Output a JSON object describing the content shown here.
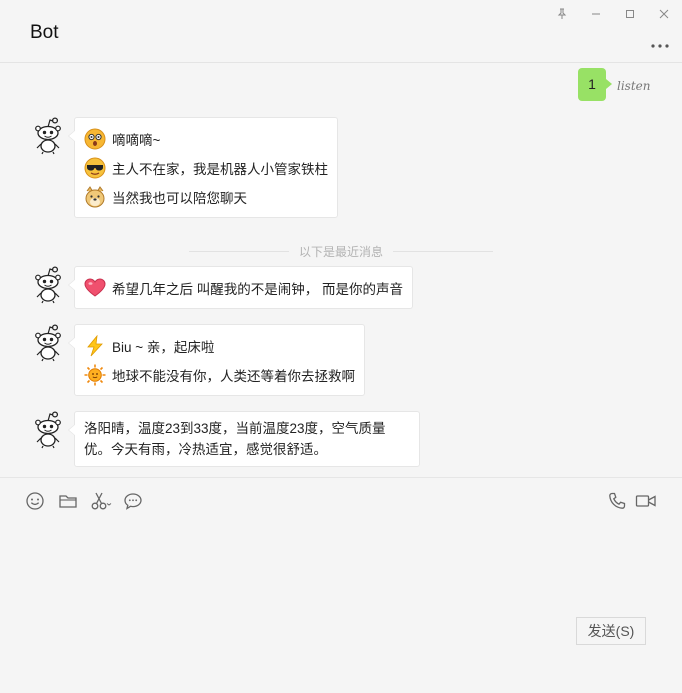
{
  "header": {
    "title": "Bot"
  },
  "window": {
    "controls": [
      "pin-icon",
      "minimize-icon",
      "maximize-icon",
      "close-icon"
    ]
  },
  "outgoing": {
    "text": "1",
    "avatar_text": "listen"
  },
  "messages": [
    {
      "lines": [
        {
          "icon": "shocked-face-icon",
          "text": "嘀嘀嘀~"
        },
        {
          "icon": "sunglasses-face-icon",
          "text": "主人不在家，我是机器人小管家铁柱"
        },
        {
          "icon": "doge-icon",
          "text": "当然我也可以陪您聊天"
        }
      ]
    },
    {
      "lines": [
        {
          "icon": "heart-icon",
          "text": "希望几年之后 叫醒我的不是闹钟， 而是你的声音"
        }
      ]
    },
    {
      "lines": [
        {
          "icon": "lightning-icon",
          "text": "Biu ~ 亲，起床啦"
        },
        {
          "icon": "sun-icon",
          "text": "地球不能没有你，人类还等着你去拯救啊"
        }
      ]
    },
    {
      "text": "洛阳晴，温度23到33度，当前温度23度，空气质量优。今天有雨，冷热适宜，感觉很舒适。"
    }
  ],
  "divider": {
    "text": "以下是最近消息"
  },
  "toolbar": {
    "left": [
      "emoji-icon",
      "folder-icon",
      "scissors-icon",
      "chat-bubble-icon"
    ],
    "right": [
      "phone-icon",
      "video-icon"
    ]
  },
  "send_button": {
    "label": "发送(S)"
  },
  "colors": {
    "outgoing_bubble": "#98e165",
    "background": "#f5f5f5"
  }
}
